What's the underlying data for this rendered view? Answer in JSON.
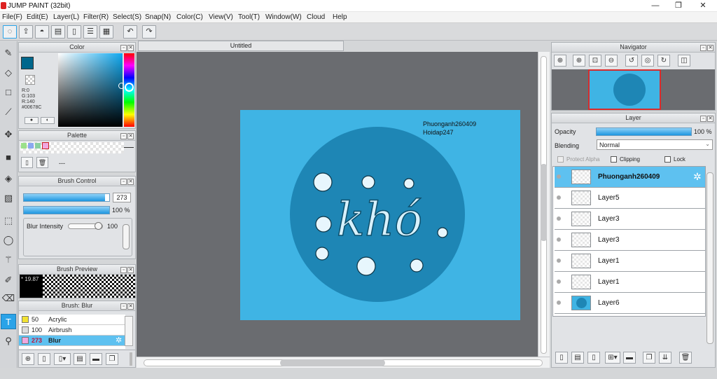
{
  "window": {
    "title": "JUMP PAINT (32bit)",
    "minimize": "—",
    "maximize": "❐",
    "close": "✕"
  },
  "menu": [
    "File(F)",
    "Edit(E)",
    "Layer(L)",
    "Filter(R)",
    "Select(S)",
    "Snap(N)",
    "Color(C)",
    "View(V)",
    "Tool(T)",
    "Window(W)",
    "Cloud",
    "Help"
  ],
  "toolbar_icons": [
    "lasso-icon",
    "export-icon",
    "speech-bubble-icon",
    "comment-icon",
    "page-icon",
    "page-list-icon",
    "grid-icon",
    "undo-icon",
    "redo-icon"
  ],
  "colors": {
    "foreground": "#00678C",
    "background": "#F0A8E0",
    "accent": "#2AA3E8",
    "canvas_bg": "#3FB4E4",
    "circle": "#1E86B5"
  },
  "color_panel": {
    "title": "Color",
    "r": "R:0",
    "g": "G:103",
    "b": "R:140",
    "hex": "#00678C"
  },
  "palette_panel": {
    "title": "Palette",
    "value": "---",
    "swatches": [
      "#9be08a",
      "#8aa8f0",
      "#8ad0a0",
      "#f0a8e0"
    ]
  },
  "brush_control": {
    "title": "Brush Control",
    "size": "273",
    "opacity": "100 %",
    "blur_label": "Blur Intensity",
    "blur_value": "100",
    "size_fill": 0.95,
    "opacity_fill": 1.0,
    "blur_fill": 0.95
  },
  "brush_preview": {
    "title": "Brush Preview",
    "size_label": "19.87"
  },
  "brush_list": {
    "title": "Brush: Blur",
    "items": [
      {
        "num": "50",
        "name": "Acrylic",
        "color": "#f2e233"
      },
      {
        "num": "100",
        "name": "Airbrush",
        "color": "#dcdcdc"
      },
      {
        "num": "273",
        "name": "Blur",
        "color": "#f0a8e0",
        "selected": true
      }
    ]
  },
  "document": {
    "tab": "Untitled",
    "signature_line1": "Phuonganh260409",
    "signature_line2": "Hoidap247",
    "artwork_text": "khó"
  },
  "navigator": {
    "title": "Navigator"
  },
  "layer_panel": {
    "title": "Layer",
    "opacity_label": "Opacity",
    "opacity_value": "100 %",
    "opacity_fill": 1.0,
    "blending_label": "Blending",
    "blending_value": "Normal",
    "protect_alpha": "Protect Alpha",
    "clipping": "Clipping",
    "lock": "Lock",
    "layers": [
      {
        "name": "Phuonganh260409",
        "selected": true
      },
      {
        "name": "Layer5"
      },
      {
        "name": "Layer3"
      },
      {
        "name": "Layer3"
      },
      {
        "name": "Layer1"
      },
      {
        "name": "Layer1"
      },
      {
        "name": "Layer6"
      }
    ]
  }
}
